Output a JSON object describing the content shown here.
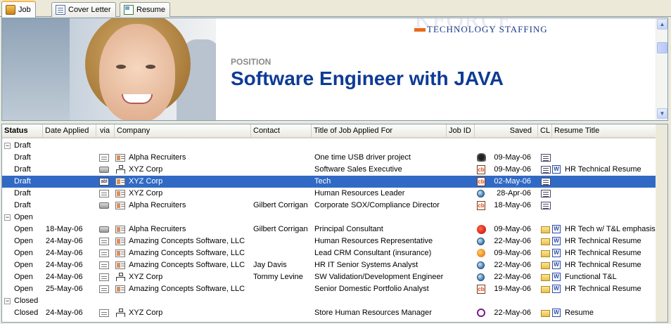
{
  "tabs": [
    {
      "label": "Job",
      "icon": "briefcase-icon",
      "active": true
    },
    {
      "label": "Cover Letter",
      "icon": "document-icon",
      "active": false
    },
    {
      "label": "Resume",
      "icon": "resume-icon",
      "active": false
    }
  ],
  "header": {
    "logo_letters": "KFORCE",
    "logo_sub": "TECHNOLOGY STAFFING",
    "position_label": "POSITION",
    "position_title": "Software Engineer with JAVA"
  },
  "columns": [
    "Status",
    "Date Applied",
    "via",
    "Company",
    "Contact",
    "Title of Job Applied For",
    "Job ID",
    "Saved",
    "CL",
    "Resume Title"
  ],
  "groups": [
    {
      "label": "Draft",
      "rows": [
        {
          "status": "Draft",
          "date": "",
          "via": "email",
          "company_icon": "company-card-icon",
          "company": "Alpha Recruiters",
          "contact": "",
          "title": "One time USB driver project",
          "source": "monitor",
          "saved": "09-May-06",
          "cl": true,
          "resume_icon": false,
          "resume": "",
          "selected": false
        },
        {
          "status": "Draft",
          "date": "",
          "via": "print",
          "company_icon": "org-chart-icon",
          "company": "XYZ Corp",
          "contact": "",
          "title": "Software Sales Executive",
          "source": "cb",
          "saved": "09-May-06",
          "cl": true,
          "resume_icon": true,
          "resume": "HR Technical Resume",
          "selected": false
        },
        {
          "status": "Draft",
          "date": "",
          "via": "web",
          "company_icon": "company-card-icon",
          "company": "XYZ Corp",
          "contact": "",
          "title": "Tech",
          "source": "cb",
          "saved": "02-May-06",
          "cl": true,
          "resume_icon": false,
          "resume": "",
          "selected": true
        },
        {
          "status": "Draft",
          "date": "",
          "via": "email",
          "company_icon": "company-card-icon",
          "company": "XYZ Corp",
          "contact": "",
          "title": "Human Resources Leader",
          "source": "globe",
          "saved": "28-Apr-06",
          "cl": true,
          "resume_icon": false,
          "resume": "",
          "selected": false
        },
        {
          "status": "Draft",
          "date": "",
          "via": "print",
          "company_icon": "company-card-icon",
          "company": "Alpha Recruiters",
          "contact": "Gilbert Corrigan",
          "title": "Corporate SOX/Compliance Director",
          "source": "cb",
          "saved": "18-May-06",
          "cl": true,
          "resume_icon": false,
          "resume": "",
          "selected": false
        }
      ]
    },
    {
      "label": "Open",
      "rows": [
        {
          "status": "Open",
          "date": "18-May-06",
          "via": "print",
          "company_icon": "company-card-icon",
          "company": "Alpha Recruiters",
          "contact": "Gilbert Corrigan",
          "title": "Principal Consultant",
          "source": "red",
          "saved": "09-May-06",
          "cl": false,
          "resume_icon": true,
          "resume": "HR Tech w/ T&L emphasis",
          "selected": false
        },
        {
          "status": "Open",
          "date": "24-May-06",
          "via": "email",
          "company_icon": "company-card-icon",
          "company": "Amazing Concepts Software, LLC",
          "contact": "",
          "title": "Human Resources Representative",
          "source": "globe",
          "saved": "22-May-06",
          "cl": false,
          "resume_icon": true,
          "resume": "HR Technical Resume",
          "selected": false
        },
        {
          "status": "Open",
          "date": "24-May-06",
          "via": "email",
          "company_icon": "company-card-icon",
          "company": "Amazing Concepts Software, LLC",
          "contact": "",
          "title": "Lead CRM Consultant (insurance)",
          "source": "orange",
          "saved": "09-May-06",
          "cl": false,
          "resume_icon": true,
          "resume": "HR Technical Resume",
          "selected": false
        },
        {
          "status": "Open",
          "date": "24-May-06",
          "via": "email",
          "company_icon": "company-card-icon",
          "company": "Amazing Concepts Software, LLC",
          "contact": "Jay Davis",
          "title": "HR IT Senior Systems Analyst",
          "source": "globe",
          "saved": "22-May-06",
          "cl": false,
          "resume_icon": true,
          "resume": "HR Technical Resume",
          "selected": false
        },
        {
          "status": "Open",
          "date": "24-May-06",
          "via": "email",
          "company_icon": "org-chart-icon",
          "company": "XYZ Corp",
          "contact": "Tommy Levine",
          "title": "SW Validation/Development Engineer",
          "source": "globe",
          "saved": "22-May-06",
          "cl": false,
          "resume_icon": true,
          "resume": "Functional T&L",
          "selected": false
        },
        {
          "status": "Open",
          "date": "25-May-06",
          "via": "email",
          "company_icon": "company-card-icon",
          "company": "Amazing Concepts Software, LLC",
          "contact": "",
          "title": "Senior Domestic Portfolio Analyst",
          "source": "cb",
          "saved": "19-May-06",
          "cl": false,
          "resume_icon": true,
          "resume": "HR Technical Resume",
          "selected": false
        }
      ]
    },
    {
      "label": "Closed",
      "rows": [
        {
          "status": "Closed",
          "date": "24-May-06",
          "via": "email",
          "company_icon": "org-chart-icon",
          "company": "XYZ Corp",
          "contact": "",
          "title": "Store Human Resources Manager",
          "source": "swirl",
          "saved": "22-May-06",
          "cl": false,
          "resume_icon": true,
          "resume": "Resume",
          "selected": false
        }
      ]
    }
  ],
  "colors": {
    "selection": "#316ac5",
    "title": "#0e3b96",
    "tab_accent": "#f7b64b"
  }
}
